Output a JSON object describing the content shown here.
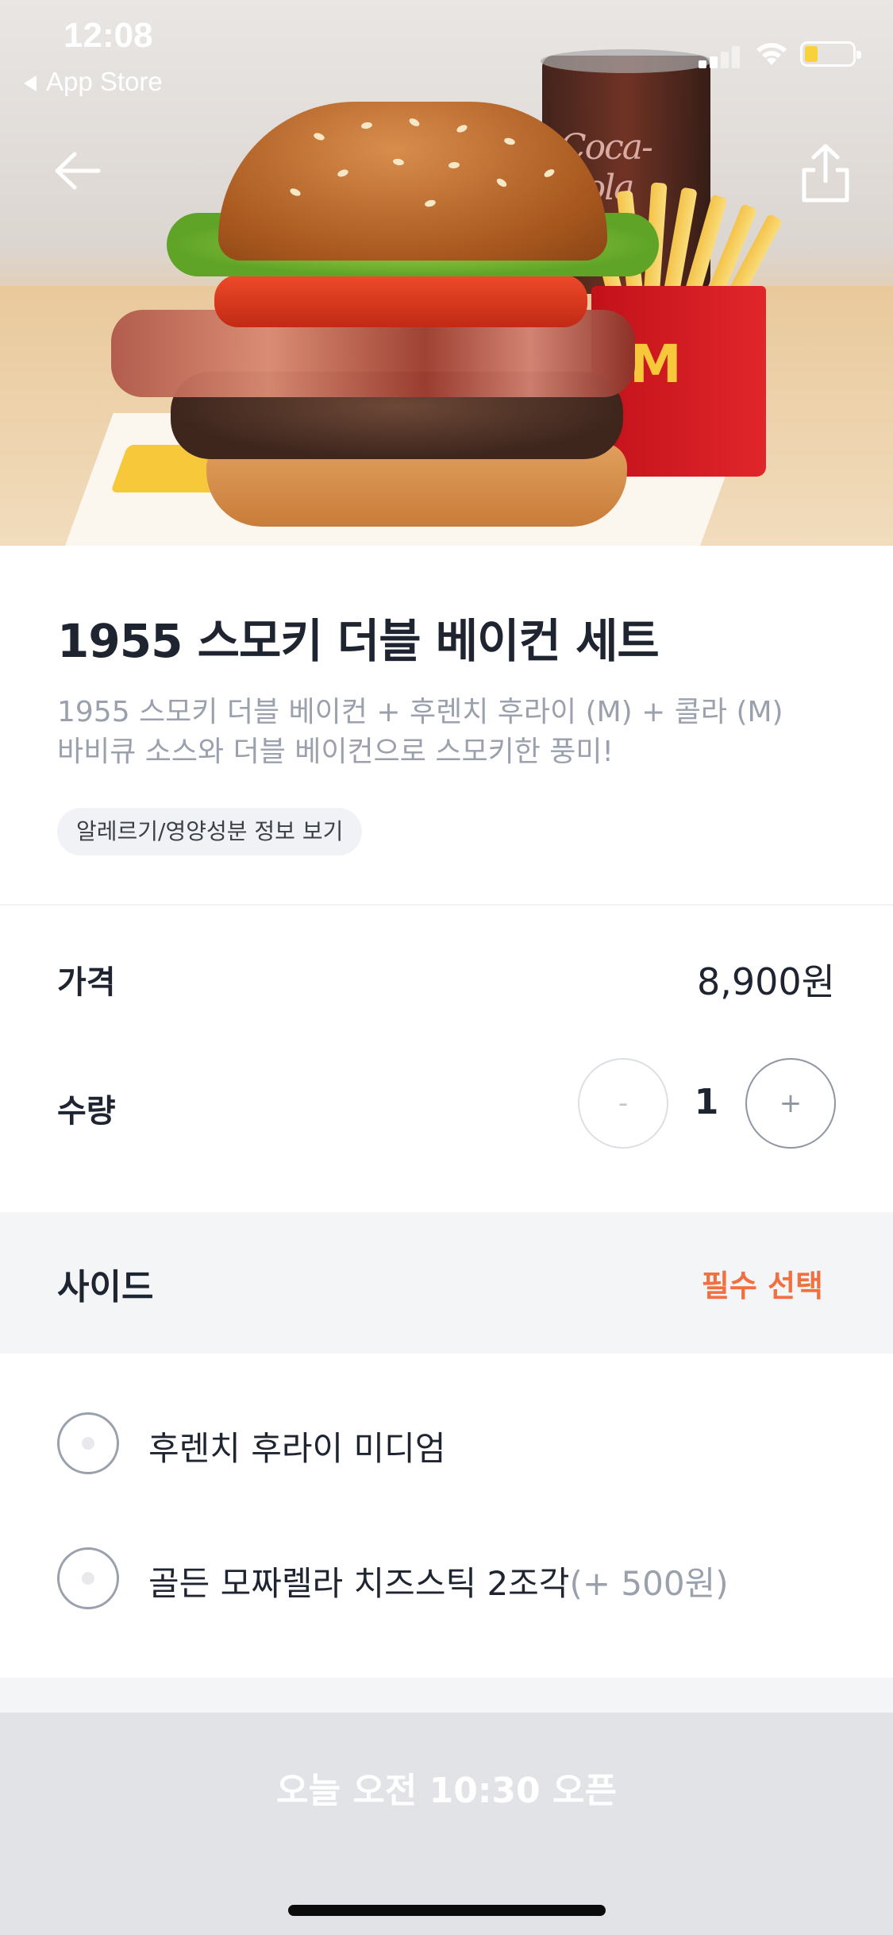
{
  "status_bar": {
    "time": "12:08",
    "back_app": "App Store"
  },
  "nav": {
    "back_icon": "arrow-left-icon",
    "share_icon": "share-icon"
  },
  "hero": {
    "drink_logo": "Coca-Cola",
    "fries_logo": "M"
  },
  "product": {
    "title": "1955 스모키 더블 베이컨 세트",
    "description_line1": "1955 스모키 더블 베이컨 + 후렌치 후라이 (M) + 콜라 (M)",
    "description_line2": "바비큐 소스와 더블 베이컨으로 스모키한 풍미!",
    "allergy_chip": "알레르기/영양성분 정보 보기"
  },
  "price_row": {
    "label": "가격",
    "value": "8,900원"
  },
  "quantity_row": {
    "label": "수량",
    "minus": "-",
    "value": "1",
    "plus": "+"
  },
  "side_section": {
    "title": "사이드",
    "required": "필수 선택",
    "options": [
      {
        "label": "후렌치 후라이 미디엄",
        "extra": ""
      },
      {
        "label": "골든 모짜렐라 치즈스틱 2조각",
        "extra": "(+ 500원)"
      }
    ]
  },
  "bottom_button": {
    "label": "오늘 오전 10:30 오픈"
  },
  "colors": {
    "accent_required": "#f07040",
    "title_text": "#1e2430",
    "muted_text": "#9aa1ad",
    "disabled_button": "#e1e3e7"
  }
}
